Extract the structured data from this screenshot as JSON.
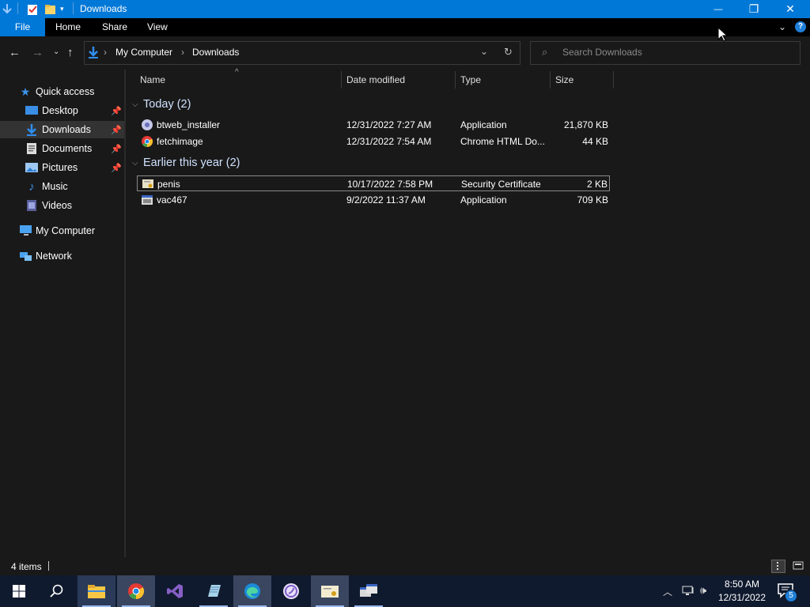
{
  "window": {
    "title": "Downloads",
    "controls": {
      "minimize": "—",
      "maximize": "❐",
      "close": "✕"
    }
  },
  "ribbon": {
    "tabs": [
      {
        "label": "File"
      },
      {
        "label": "Home"
      },
      {
        "label": "Share"
      },
      {
        "label": "View"
      }
    ],
    "help": "?"
  },
  "address": {
    "segments": [
      "My Computer",
      "Downloads"
    ],
    "separator": "›"
  },
  "search": {
    "placeholder": "Search Downloads"
  },
  "nav": {
    "items": [
      {
        "label": "Quick access",
        "icon": "star-icon"
      },
      {
        "label": "Desktop",
        "icon": "desktop-icon",
        "pinned": true
      },
      {
        "label": "Downloads",
        "icon": "download-icon",
        "pinned": true,
        "selected": true
      },
      {
        "label": "Documents",
        "icon": "documents-icon",
        "pinned": true
      },
      {
        "label": "Pictures",
        "icon": "pictures-icon",
        "pinned": true
      },
      {
        "label": "Music",
        "icon": "music-icon"
      },
      {
        "label": "Videos",
        "icon": "videos-icon"
      },
      {
        "label": "My Computer",
        "icon": "computer-icon"
      },
      {
        "label": "Network",
        "icon": "network-icon"
      }
    ]
  },
  "columns": [
    {
      "label": "Name"
    },
    {
      "label": "Date modified"
    },
    {
      "label": "Type"
    },
    {
      "label": "Size"
    }
  ],
  "groups": [
    {
      "label": "Today (2)",
      "files": [
        {
          "name": "btweb_installer",
          "date": "12/31/2022 7:27 AM",
          "type": "Application",
          "size": "21,870 KB",
          "icon": "installer-icon"
        },
        {
          "name": "fetchimage",
          "date": "12/31/2022 7:54 AM",
          "type": "Chrome HTML Do...",
          "size": "44 KB",
          "icon": "chrome-file-icon"
        }
      ]
    },
    {
      "label": "Earlier this year (2)",
      "files": [
        {
          "name": "penis",
          "date": "10/17/2022 7:58 PM",
          "type": "Security Certificate",
          "size": "2 KB",
          "icon": "certificate-icon"
        },
        {
          "name": "vac467",
          "date": "9/2/2022 11:37 AM",
          "type": "Application",
          "size": "709 KB",
          "icon": "application-icon"
        }
      ]
    }
  ],
  "status": {
    "item_count": "4 items"
  },
  "taskbar": {
    "clock_time": "8:50 AM",
    "clock_date": "12/31/2022",
    "notification_count": "5"
  },
  "colors": {
    "titlebar": "#0078d7",
    "background": "#191919",
    "taskbar": "#101a2e",
    "group_text": "#cfe2ff"
  }
}
